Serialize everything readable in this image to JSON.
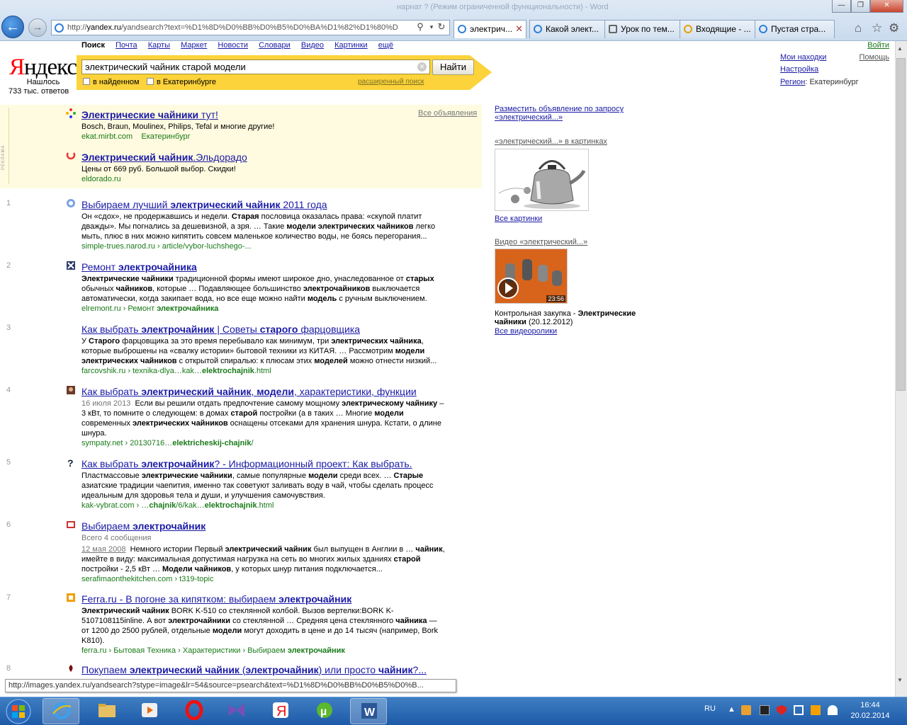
{
  "browser": {
    "faded_title": "нарнат ? (Режим ограниченной функциональности) - Word",
    "address": {
      "prefix": "http://",
      "host": "yandex.ru",
      "rest": "/yandsearch?text=%D1%8D%D0%BB%D0%B5%D0%BA%D1%82%D1%80%D"
    },
    "tabs": [
      {
        "label": "электрич...",
        "active": true
      },
      {
        "label": "Какой элект..."
      },
      {
        "label": "Урок по тем..."
      },
      {
        "label": "Входящие - ..."
      },
      {
        "label": "Пустая стра..."
      }
    ],
    "status_url": "http://images.yandex.ru/yandsearch?stype=image&lr=54&source=psearch&text=%D1%8D%D0%BB%D0%B5%D0%B..."
  },
  "header": {
    "logo_ya": "Я",
    "logo_rest": "ндекс",
    "found_line1": "Нашлось",
    "found_line2": "733 тыс. ответов",
    "services": [
      "Поиск",
      "Почта",
      "Карты",
      "Маркет",
      "Новости",
      "Словари",
      "Видео",
      "Картинки",
      "ещё"
    ],
    "search_value": "электрический чайник старой модели",
    "search_button": "Найти",
    "check_found": "в найденном",
    "check_region": "в Екатеринбурге",
    "advanced": "расширенный поиск",
    "login": "Войти",
    "help": "Помощь",
    "my_finds": "Мои находки",
    "settings": "Настройка",
    "region_label": "Регион",
    "region_value": ": Екатеринбург"
  },
  "ads": {
    "label": "РЕКЛАМА",
    "all_ads": "Все объявления",
    "items": [
      {
        "title_bold": "Электрические чайники",
        "title_rest": " тут!",
        "snippet": "Bosch, Braun, Moulinex, Philips, Tefal и многие другие!",
        "url": "ekat.mirbt.com",
        "city": "Екатеринбург"
      },
      {
        "title_bold": "Электрический чайник",
        "title_rest": ".Эльдорадо",
        "snippet": "Цены от 669 руб. Большой выбор. Скидки!",
        "url": "eldorado.ru",
        "city": ""
      }
    ]
  },
  "results": [
    {
      "n": "1",
      "title": "Выбираем лучший <b>электрический чайник</b> 2011 года",
      "snippet": "Он «сдох», не продержавшись и недели. <b>Старая</b> пословица оказалась права: «скупой платит дважды». Мы погнались за дешевизной, а зря. … Такие <b>модели электрических чайников</b> легко мыть, плюс в них можно кипятить совсем маленькое количество воды, не боясь перегорания...",
      "url": "simple-trues.narod.ru › article/vybor-luchshego-..."
    },
    {
      "n": "2",
      "title": "Ремонт <b>электрочайника</b>",
      "snippet": "<b>Электрические чайники</b> традиционной формы имеют широкое дно, унаследованное от <b>старых</b> обычных <b>чайников</b>, которые … Подавляющее большинство <b>электрочайников</b> выключается автоматически, когда закипает вода, но все еще можно найти <b>модель</b> с ручным выключением.",
      "url": "elremont.ru › Ремонт <b>электрочайника</b>"
    },
    {
      "n": "3",
      "title": "Как выбрать <b>электрочайник</b> | Советы <b>старого</b> фарцовщика",
      "snippet": "У <b>Старого</b> фарцовщика за это время перебывало как минимум, три <b>электрических чайника</b>, которые выброшены на «свалку истории» бытовой техники из КИТАЯ. … Рассмотрим <b>модели электрических чайников</b> с открытой спиралью: к плюсам этих <b>моделей</b> можно отнести низкий...",
      "url": "farcovshik.ru › texnika-dlya…kak…<b>elektrochajnik</b>.html"
    },
    {
      "n": "4",
      "title": "Как выбрать <b>электрический чайник</b>, <b>модели</b>, характеристики, функции",
      "date": "16 июля 2013",
      "snippet": "Если вы решили отдать предпочтение самому мощному <b>электрическому чайнику</b> – 3 кВт, то помните о следующем: в домах <b>старой</b> постройки (а в таких … Многие <b>модели</b> современных <b>электрических чайников</b> оснащены отсеками для хранения шнура. Кстати, о длине шнура.",
      "url": "sympaty.net › 20130716…<b>elektricheskij-chajnik</b>/"
    },
    {
      "n": "5",
      "title": "Как выбрать <b>электрочайник</b>? - Информационный проект: Как выбрать.",
      "snippet": "Пластмассовые <b>электрические чайники</b>, самые популярные <b>модели</b> среди всех. … <b>Старые</b> азиатские традиции чаепития, именно так советуют заливать воду в чай, чтобы сделать процесс идеальным для здоровья тела и души, и улучшения самочувствия.",
      "url": "kak-vybrat.com › …<b>chajnik</b>/6/kak…<b>elektrochajnik</b>.html"
    },
    {
      "n": "6",
      "title": "Выбираем <b>электрочайник</b>",
      "extra": "Всего 4 сообщения",
      "date": "12 мая 2008",
      "snippet": "Немного истории Первый <b>электрический чайник</b> был выпущен в Англии в … <b>чайник</b>, имейте в виду: максимальная допустимая нагрузка на сеть во многих жилых зданиях <b>старой</b> постройки - 2,5 кВт … <b>Модели чайников</b>, у которых шнур питания подключается...",
      "url": "serafimaonthekitchen.com › t319-topic"
    },
    {
      "n": "7",
      "title": "Ferra.ru - В погоне за кипятком: выбираем <b>электрочайник</b>",
      "snippet": "<b>Электрический чайник</b> BORK K-510 со стеклянной колбой. Вызов вертелки:BORK K-5107108115inline. А вот <b>электрочайники</b> со стеклянной … Средняя цена стеклянного <b>чайника</b> — от 1200 до 2500 рублей, отдельные <b>модели</b> могут доходить в цене и до 14 тысяч (например, Bork K810).",
      "url": "ferra.ru › Бытовая Техника › Характеристики › Выбираем <b>электрочайник</b>"
    },
    {
      "n": "8",
      "title": "Покупаем <b>электрический чайник</b> (<b>электрочайник</b>) или просто <b>чайник</b>?...",
      "snippet": "",
      "url": ""
    }
  ],
  "sidebar": {
    "place_ad": "Разместить объявление по запросу «электрический...»",
    "images_head": "«электрический...» в картинках",
    "all_images": "Все картинки",
    "video_head": "Видео «электрический...»",
    "video_time": "23:56",
    "video_title": "Контрольная закупка - <b>Электрические чайники</b> (20.12.2012)",
    "all_videos": "Все видеоролики"
  },
  "taskbar": {
    "lang": "RU",
    "time": "16:44",
    "date": "20.02.2014"
  },
  "colors": {
    "link": "#1a1aa6",
    "url_green": "#1a7a1a",
    "ad_bg": "#fffbe0",
    "search_yellow": "#fcd33a",
    "taskbar": "#2c66b4"
  }
}
